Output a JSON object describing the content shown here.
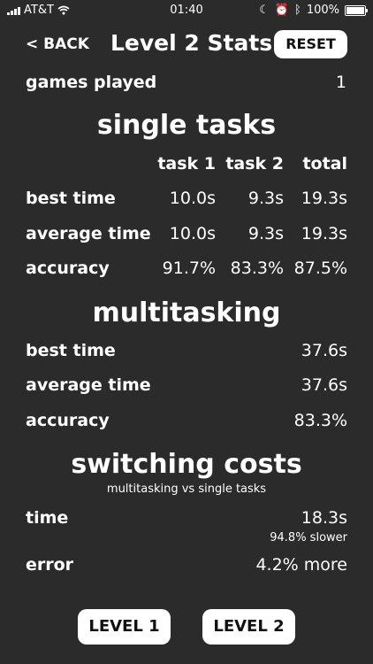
{
  "status_bar": {
    "carrier": "AT&T",
    "time": "01:40",
    "battery": "100%"
  },
  "header": {
    "back_label": "< BACK",
    "title": "Level 2 Stats",
    "reset_label": "RESET"
  },
  "games_played": {
    "label": "games played",
    "value": "1"
  },
  "single_tasks": {
    "title": "single tasks",
    "columns": [
      "task 1",
      "task 2",
      "total"
    ],
    "rows": [
      {
        "label": "best time",
        "values": [
          "10.0s",
          "9.3s",
          "19.3s"
        ]
      },
      {
        "label": "average time",
        "values": [
          "10.0s",
          "9.3s",
          "19.3s"
        ]
      },
      {
        "label": "accuracy",
        "values": [
          "91.7%",
          "83.3%",
          "87.5%"
        ]
      }
    ]
  },
  "multitasking": {
    "title": "multitasking",
    "rows": [
      {
        "label": "best time",
        "value": "37.6s"
      },
      {
        "label": "average time",
        "value": "37.6s"
      },
      {
        "label": "accuracy",
        "value": "83.3%"
      }
    ]
  },
  "switching_costs": {
    "title": "switching costs",
    "subtitle": "multitasking vs single tasks",
    "time_label": "time",
    "time_value": "18.3s",
    "time_note": "94.8% slower",
    "error_label": "error",
    "error_value": "4.2% more"
  },
  "footer": {
    "level1_label": "LEVEL 1",
    "level2_label": "LEVEL 2"
  }
}
